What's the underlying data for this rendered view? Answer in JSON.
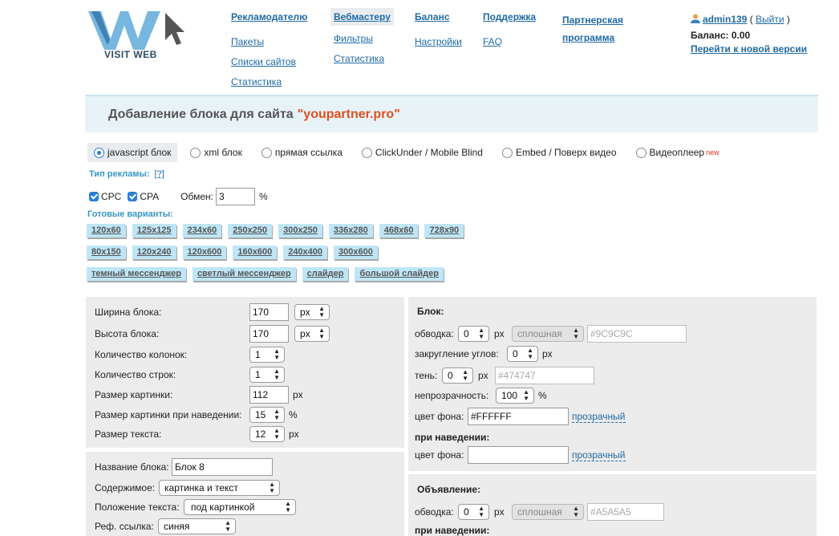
{
  "header": {
    "logo_text": "VISIT WEB",
    "nav": [
      {
        "label": "Рекламодателю",
        "items": [
          "Пакеты",
          "Списки сайтов",
          "Статистика"
        ]
      },
      {
        "label": "Вебмастеру",
        "items": [
          "Фильтры",
          "Статистика"
        ],
        "active": true
      },
      {
        "label": "Баланс",
        "items": [
          "Настройки"
        ]
      },
      {
        "label": "Поддержка",
        "items": [
          "FAQ"
        ]
      },
      {
        "label": "Партнерская программа",
        "label_line1": "Партнерская",
        "label_line2": "программа",
        "items": []
      }
    ],
    "user": {
      "name": "admin139",
      "logout": "Выйти",
      "open_paren": "(",
      "close_paren": ")",
      "balance_label": "Баланс:",
      "balance_value": "0.00",
      "new_version_link": "Перейти к новой версии"
    }
  },
  "title": {
    "text": "Добавление блока для сайта",
    "site": "\"youpartner.pro\""
  },
  "types": [
    {
      "label": "javascript блок",
      "selected": true
    },
    {
      "label": "xml блок",
      "selected": false
    },
    {
      "label": "прямая ссылка",
      "selected": false
    },
    {
      "label": "ClickUnder / Mobile Blind",
      "selected": false
    },
    {
      "label": "Embed / Поверх видео",
      "selected": false
    },
    {
      "label": "Видеоплеер",
      "selected": false,
      "badge": "new"
    }
  ],
  "ad_type": {
    "label": "Тип рекламы:",
    "help": "[?]",
    "cpc": "CPC",
    "cpa": "CPA",
    "exchange_label": "Обмен:",
    "exchange_value": "3",
    "percent": "%"
  },
  "presets": {
    "label": "Готовые варианты:",
    "rows": [
      [
        "120x60",
        "125x125",
        "234x60",
        "250x250",
        "300x250",
        "336x280",
        "468x60",
        "728x90"
      ],
      [
        "80x150",
        "120x240",
        "120x600",
        "160x600",
        "240x400",
        "300x600"
      ],
      [
        "темный мессенджер",
        "светлый мессенджер",
        "слайдер",
        "большой слайдер"
      ]
    ]
  },
  "left_panel": {
    "width_label": "Ширина блока:",
    "width_value": "170",
    "width_unit": "px",
    "height_label": "Высота блока:",
    "height_value": "170",
    "height_unit": "px",
    "cols_label": "Количество колонок:",
    "cols_value": "1",
    "rows_label": "Количество строк:",
    "rows_value": "1",
    "img_label": "Размер картинки:",
    "img_value": "112",
    "img_unit": "px",
    "img_hover_label": "Размер картинки при наведении:",
    "img_hover_value": "15",
    "img_hover_unit": "%",
    "text_size_label": "Размер текста:",
    "text_size_value": "12",
    "text_size_unit": "px"
  },
  "left_panel2": {
    "name_label": "Название блока:",
    "name_value": "Блок 8",
    "content_label": "Содержимое:",
    "content_value": "картинка и текст",
    "text_pos_label": "Положение текста:",
    "text_pos_value": "под картинкой",
    "ref_label": "Реф. ссылка:",
    "ref_value": "синяя"
  },
  "right_panel": {
    "heading": "Блок:",
    "border_label": "обводка:",
    "border_value": "0",
    "border_unit": "px",
    "border_style": "сплошная",
    "border_color": "#9C9C9C",
    "radius_label": "закругление углов:",
    "radius_value": "0",
    "radius_unit": "px",
    "shadow_label": "тень:",
    "shadow_value": "0",
    "shadow_unit": "px",
    "shadow_color": "#474747",
    "opacity_label": "непрозрачность:",
    "opacity_value": "100",
    "opacity_unit": "%",
    "bg_label": "цвет фона:",
    "bg_value": "#FFFFFF",
    "transparent": "прозрачный",
    "hover_heading": "при наведении:",
    "hover_bg_label": "цвет фона:",
    "hover_bg_value": "",
    "hover_transparent": "прозрачный"
  },
  "right_panel2": {
    "heading": "Объявление:",
    "border_label": "обводка:",
    "border_value": "0",
    "border_unit": "px",
    "border_style": "сплошная",
    "border_color": "#A5A5A5",
    "hover_heading": "при наведении:"
  }
}
